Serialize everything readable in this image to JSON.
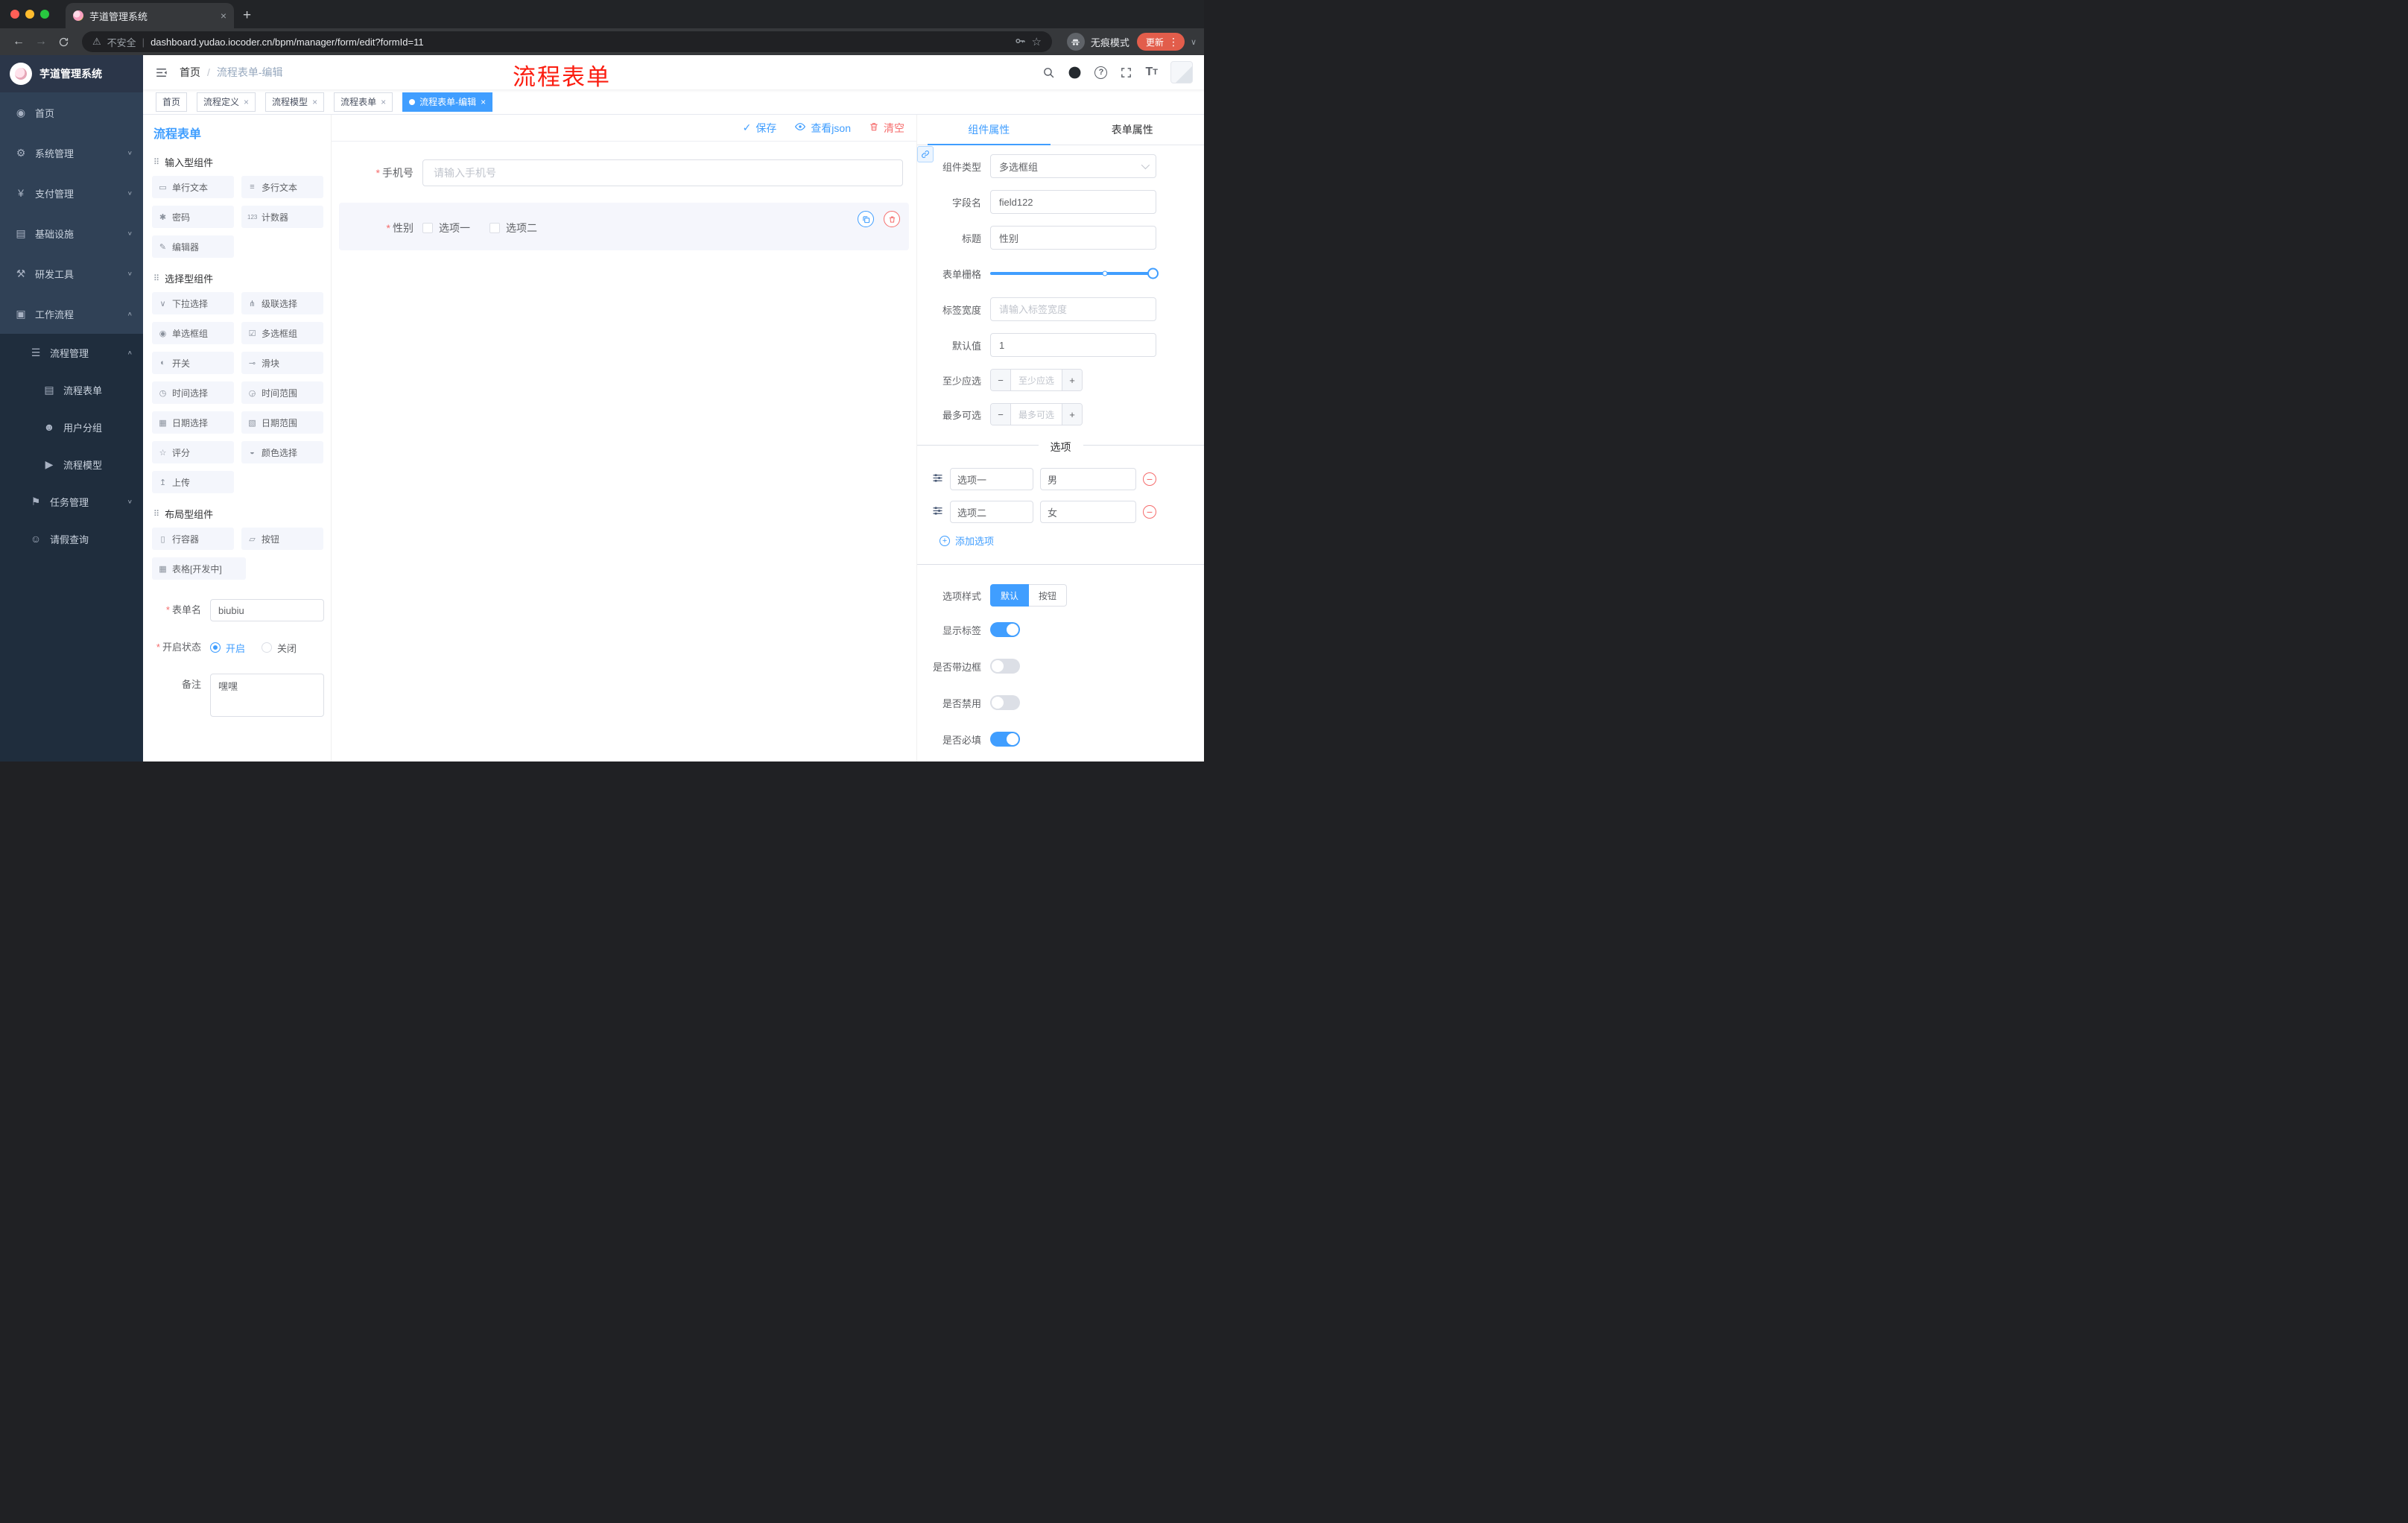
{
  "colors": {
    "primary": "#409eff",
    "danger": "#f56c6c",
    "annotation_red": "#fb1d10",
    "sidebar_bg": "#304156",
    "sidebar_sub_bg": "#1f2d3d"
  },
  "browser": {
    "tab_title": "芋道管理系统",
    "security_label": "不安全",
    "url": "dashboard.yudao.iocoder.cn/bpm/manager/form/edit?formId=11",
    "incognito_label": "无痕模式",
    "update_label": "更新"
  },
  "annotation": "流程表单",
  "icons": {
    "back": "←",
    "forward": "→",
    "warning": "⚠",
    "star": "☆",
    "dots": "⋮",
    "chevron_down": "∨",
    "chevron_up": "∧",
    "close": "×",
    "plus_tab": "+",
    "check": "✓",
    "minus": "−",
    "plus": "+",
    "section": "⠿",
    "dashboard": "◉",
    "gear": "⚙",
    "yen": "¥",
    "infra": "▤",
    "tools": "⚒",
    "workflow": "▣",
    "list": "☰",
    "doc": "▤",
    "users": "☻",
    "send": "▶",
    "tasks": "⚑",
    "person": "☺",
    "item_single": "▭",
    "item_multi": "≡",
    "item_pwd": "✱",
    "item_counter": "123",
    "item_editor": "✎",
    "item_select": "∨",
    "item_cascade": "⋔",
    "item_radio": "◉",
    "item_checkbox": "☑",
    "item_switch": "◐",
    "item_slider": "⊸",
    "item_time": "◷",
    "item_timerange": "◶",
    "item_date": "▦",
    "item_daterange": "▧",
    "item_rate": "☆",
    "item_color": "◒",
    "item_upload": "↥",
    "item_row": "▯",
    "item_button": "▱",
    "item_table": "▦"
  },
  "sidebar": {
    "logo_title": "芋道管理系统",
    "menu": [
      {
        "label": "首页"
      },
      {
        "label": "系统管理"
      },
      {
        "label": "支付管理"
      },
      {
        "label": "基础设施"
      },
      {
        "label": "研发工具"
      },
      {
        "label": "工作流程"
      },
      {
        "label": "流程管理"
      },
      {
        "label": "流程表单"
      },
      {
        "label": "用户分组"
      },
      {
        "label": "流程模型"
      },
      {
        "label": "任务管理"
      },
      {
        "label": "请假查询"
      }
    ]
  },
  "header": {
    "breadcrumb_home": "首页",
    "breadcrumb_current": "流程表单-编辑"
  },
  "tags": [
    {
      "label": "首页"
    },
    {
      "label": "流程定义"
    },
    {
      "label": "流程模型"
    },
    {
      "label": "流程表单"
    },
    {
      "label": "流程表单-编辑"
    }
  ],
  "palette": {
    "title": "流程表单",
    "section_input": "输入型组件",
    "input_items": [
      "单行文本",
      "多行文本",
      "密码",
      "计数器",
      "编辑器"
    ],
    "section_select": "选择型组件",
    "select_items": [
      "下拉选择",
      "级联选择",
      "单选框组",
      "多选框组",
      "开关",
      "滑块",
      "时间选择",
      "时间范围",
      "日期选择",
      "日期范围",
      "评分",
      "颜色选择",
      "上传"
    ],
    "section_layout": "布局型组件",
    "layout_items": [
      "行容器",
      "按钮",
      "表格[开发中]"
    ]
  },
  "form_meta": {
    "name_label": "表单名",
    "name_value": "biubiu",
    "status_label": "开启状态",
    "status_on": "开启",
    "status_off": "关闭",
    "remark_label": "备注",
    "remark_value": "嘿嘿"
  },
  "toolbar": {
    "save": "保存",
    "view_json": "查看json",
    "clear": "清空"
  },
  "canvas": {
    "phone_label": "手机号",
    "phone_placeholder": "请输入手机号",
    "gender_label": "性别",
    "gender_options": [
      "选项一",
      "选项二"
    ]
  },
  "props": {
    "tab_component": "组件属性",
    "tab_form": "表单属性",
    "rows": {
      "component_type_label": "组件类型",
      "component_type_value": "多选框组",
      "field_name_label": "字段名",
      "field_name_value": "field122",
      "title_label": "标题",
      "title_value": "性别",
      "grid_label": "表单栅格",
      "label_width_label": "标签宽度",
      "label_width_placeholder": "请输入标签宽度",
      "default_label": "默认值",
      "default_value": "1",
      "min_label": "至少应选",
      "min_placeholder": "至少应选",
      "max_label": "最多可选",
      "max_placeholder": "最多可选"
    },
    "options_title": "选项",
    "options": [
      {
        "label": "选项一",
        "value": "男"
      },
      {
        "label": "选项二",
        "value": "女"
      }
    ],
    "add_option": "添加选项",
    "style_label": "选项样式",
    "style_default": "默认",
    "style_button": "按钮",
    "toggles": [
      {
        "label": "显示标签",
        "on": true
      },
      {
        "label": "是否带边框",
        "on": false
      },
      {
        "label": "是否禁用",
        "on": false
      },
      {
        "label": "是否必填",
        "on": true
      }
    ]
  }
}
